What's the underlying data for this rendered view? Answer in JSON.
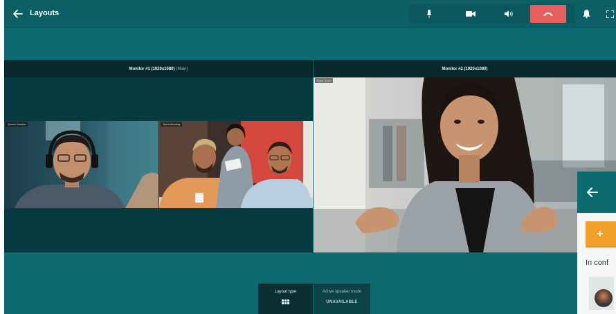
{
  "header": {
    "title": "Layouts",
    "back_icon": "arrow-left-icon",
    "controls": [
      {
        "name": "microphone",
        "icon": "microphone-icon"
      },
      {
        "name": "camera",
        "icon": "video-camera-icon"
      },
      {
        "name": "speaker",
        "icon": "speaker-icon"
      },
      {
        "name": "hang-up",
        "icon": "phone-hangup-icon"
      }
    ],
    "right_icons": [
      "bell-icon",
      "fullscreen-icon"
    ]
  },
  "monitors": [
    {
      "name": "Monitor #1 (1920x1080)",
      "suffix": "(Main)",
      "tiles": [
        {
          "label": "Ahmed Nasser"
        },
        {
          "label": "Team Meeting"
        }
      ]
    },
    {
      "name": "Monitor #2 (1920x1080)",
      "suffix": "",
      "tiles": [
        {
          "label": "Rose Scott"
        }
      ]
    }
  ],
  "panel": {
    "back_icon": "arrow-left-icon",
    "add_label": "+",
    "in_conference_label": "In conf"
  },
  "layout_bar": {
    "layout_type_label": "Layout type",
    "layout_type_icon": "grid-icon",
    "active_speaker_label": "Active speaker mode",
    "active_speaker_value": "UNAVAILABLE"
  },
  "colors": {
    "background": "#0d6a70",
    "topbar": "#0b5f65",
    "monitor_header": "#06272b",
    "hangup": "#e65e5e",
    "accent": "#f0a028"
  }
}
